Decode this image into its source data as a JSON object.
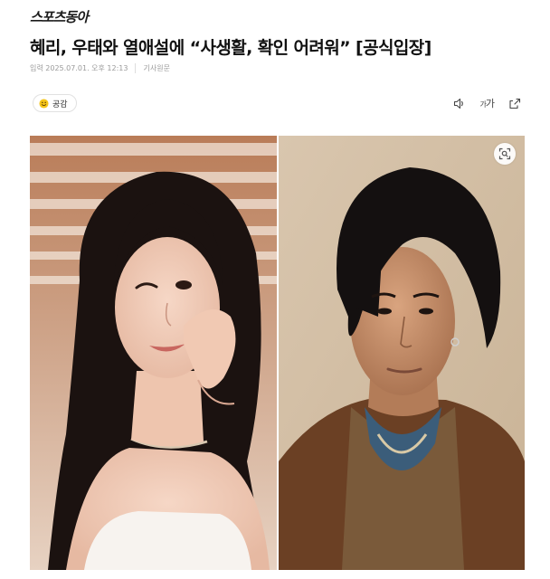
{
  "header": {
    "logo": "스포츠동아"
  },
  "article": {
    "headline": "혜리, 우태와 열애설에 “사생활, 확인 어려워” [공식입장]",
    "published": "입력 2025.07.01. 오후 12:13",
    "source_link": "기사원문",
    "empathy_label": "공감"
  },
  "toolbar": {
    "font_size_label": "가"
  },
  "icons": {
    "empathy": "smile-icon",
    "listen": "speaker-icon",
    "font_size": "font-size-icon",
    "share": "share-icon",
    "image_search": "lens-search-icon"
  },
  "colors": {
    "empathy_icon": "#f5c518",
    "headline": "#111111",
    "meta": "#9a9a9a"
  }
}
